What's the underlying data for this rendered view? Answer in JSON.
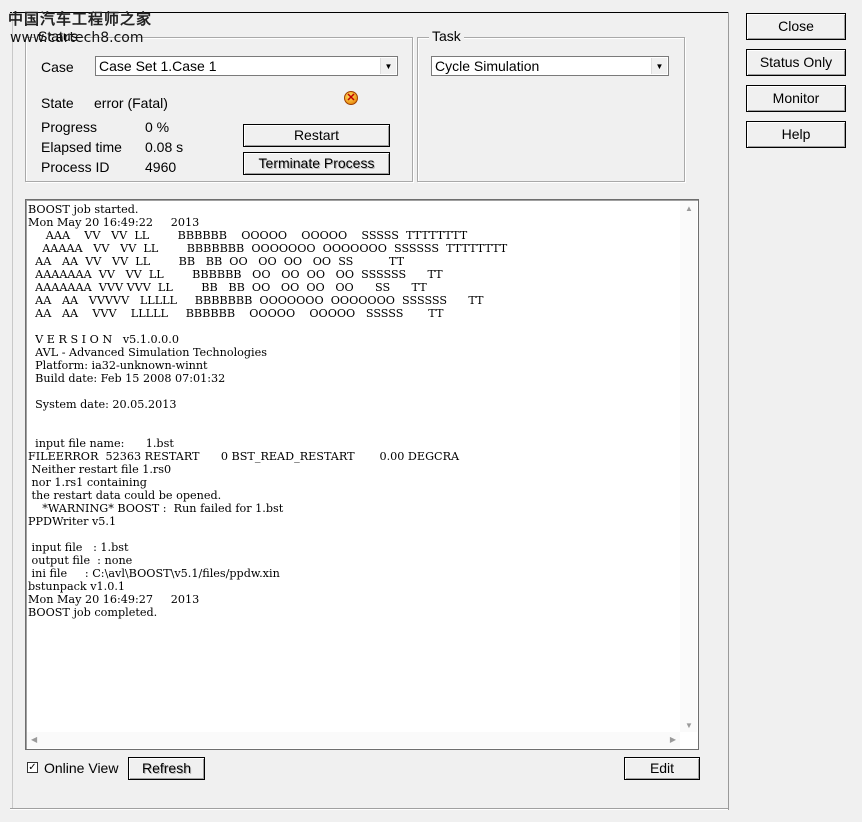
{
  "watermark": {
    "line1": "中国汽车工程师之家",
    "line2": "www.cartech8.com"
  },
  "status": {
    "group_title": "Status",
    "case_label": "Case",
    "case_value": "Case Set 1.Case 1",
    "state_label": "State",
    "state_value": "error (Fatal)",
    "state_icon": "error-x-icon",
    "progress_label": "Progress",
    "progress_value": "0 %",
    "elapsed_label": "Elapsed time",
    "elapsed_value": "0.08 s",
    "pid_label": "Process ID",
    "pid_value": "4960",
    "restart_label": "Restart",
    "terminate_label": "Terminate Process"
  },
  "task": {
    "group_title": "Task",
    "value": "Cycle Simulation"
  },
  "side_buttons": {
    "close": "Close",
    "status_only": "Status Only",
    "monitor": "Monitor",
    "help": "Help"
  },
  "log": {
    "text": "BOOST job started.\nMon May 20 16:49:22     2013\n     AAA    VV   VV  LL        BBBBBB    OOOOO    OOOOO    SSSSS  TTTTTTTT\n    AAAAA   VV   VV  LL        BBBBBBB  OOOOOOO  OOOOOOO  SSSSSS  TTTTTTTT\n  AA   AA  VV   VV  LL        BB   BB  OO   OO  OO   OO  SS          TT\n  AAAAAAA  VV   VV  LL        BBBBBB   OO   OO  OO   OO  SSSSSS      TT\n  AAAAAAA  VVV VVV  LL        BB   BB  OO   OO  OO   OO      SS      TT\n  AA   AA   VVVVV   LLLLL     BBBBBBB  OOOOOOO  OOOOOOO  SSSSSS      TT\n  AA   AA    VVV    LLLLL     BBBBBB    OOOOO    OOOOO   SSSSS       TT\n\n  V E R S I O N   v5.1.0.0.0\n  AVL - Advanced Simulation Technologies\n  Platform: ia32-unknown-winnt\n  Build date: Feb 15 2008 07:01:32\n\n  System date: 20.05.2013\n\n\n  input file name:      1.bst\nFILEERROR  52363 RESTART      0 BST_READ_RESTART       0.00 DEGCRA\n Neither restart file 1.rs0\n nor 1.rs1 containing\n the restart data could be opened.\n    *WARNING* BOOST :  Run failed for 1.bst\nPPDWriter v5.1\n\n input file   : 1.bst\n output file  : none\n ini file     : C:\\avl\\BOOST\\v5.1/files/ppdw.xin\nbstunpack v1.0.1\nMon May 20 16:49:27     2013\nBOOST job completed."
  },
  "footer": {
    "online_view_label": "Online View",
    "online_view_checked": true,
    "refresh_label": "Refresh",
    "edit_label": "Edit"
  }
}
